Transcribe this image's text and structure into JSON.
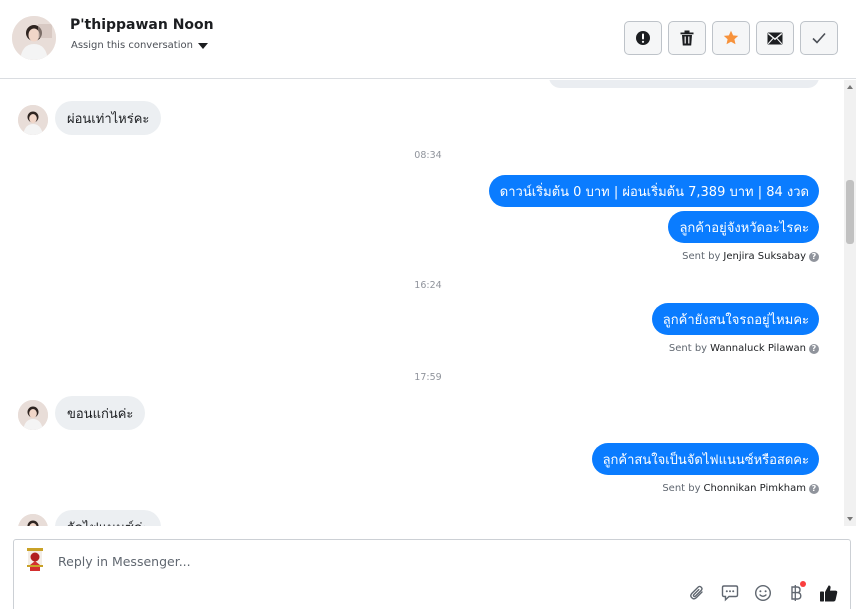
{
  "header": {
    "contact_name": "P'thippawan Noon",
    "assign_label": "Assign this conversation",
    "tools": [
      {
        "name": "mark-spam-button",
        "icon": "exclamation-icon"
      },
      {
        "name": "delete-button",
        "icon": "trash-icon"
      },
      {
        "name": "star-button",
        "icon": "star-icon",
        "color": "#f7923b"
      },
      {
        "name": "mark-unread-button",
        "icon": "envelope-icon"
      },
      {
        "name": "mark-done-button",
        "icon": "checkmark-icon"
      }
    ]
  },
  "conversation": {
    "messages": [
      {
        "direction": "in",
        "text": "ผ่อนเท่าไหร่คะ"
      },
      {
        "type": "time",
        "text": "08:34"
      },
      {
        "direction": "out",
        "text": "ดาวน์เริ่มต้น 0 บาท | ผ่อนเริ่มต้น 7,389 บาท | 84 งวด"
      },
      {
        "direction": "out",
        "text": "ลูกค้าอยู่จังหวัดอะไรคะ"
      },
      {
        "type": "sent_by",
        "prefix": "Sent by",
        "agent": "Jenjira Suksabay"
      },
      {
        "type": "time",
        "text": "16:24"
      },
      {
        "direction": "out",
        "text": "ลูกค้ายังสนใจรถอยู่ไหมคะ"
      },
      {
        "type": "sent_by",
        "prefix": "Sent by",
        "agent": "Wannaluck Pilawan"
      },
      {
        "type": "time",
        "text": "17:59"
      },
      {
        "direction": "in",
        "text": "ขอนแก่นค่ะ"
      },
      {
        "direction": "out",
        "text": "ลูกค้าสนใจเป็นจัดไฟแนนซ์หรือสดคะ"
      },
      {
        "type": "sent_by",
        "prefix": "Sent by",
        "agent": "Chonnikan Pimkham"
      },
      {
        "direction": "in",
        "text": "จัดไฟแนนซ์ค่ะ"
      }
    ],
    "help_glyph": "?"
  },
  "composer": {
    "placeholder": "Reply in Messenger...",
    "value": "",
    "icons": [
      "paperclip-icon",
      "saved-reply-icon",
      "emoji-icon",
      "baht-payment-icon",
      "thumbs-up-icon"
    ]
  },
  "colors": {
    "outgoing_bubble": "#0a7cff",
    "incoming_bubble": "#eceff2",
    "star": "#f7923b",
    "notification_dot": "#fa3e3e"
  }
}
